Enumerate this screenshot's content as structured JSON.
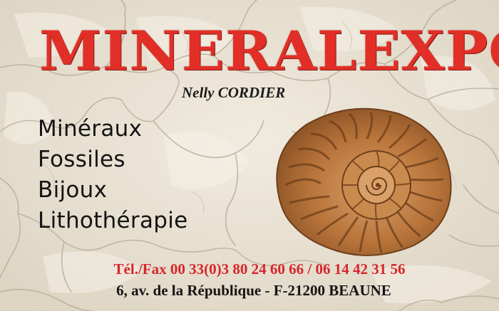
{
  "card": {
    "brand": "MINERALEXPO",
    "person": "Nelly CORDIER",
    "products": [
      "Minéraux",
      "Fossiles",
      "Bijoux",
      "Lithothérapie"
    ],
    "contact": {
      "phone": "Tél./Fax 00 33(0)3 80 24 60 66 / 06 14 42 31 56",
      "address": "6, av. de la République - F-21200 BEAUNE"
    }
  },
  "colors": {
    "brand": "#e12f27",
    "phone": "#d7262b",
    "text": "#141414",
    "background": "#e9e2d3",
    "fossil": "#b8743a"
  },
  "icons": {
    "background": "cracked-limestone-texture",
    "illustration": "ammonite-fossil"
  }
}
